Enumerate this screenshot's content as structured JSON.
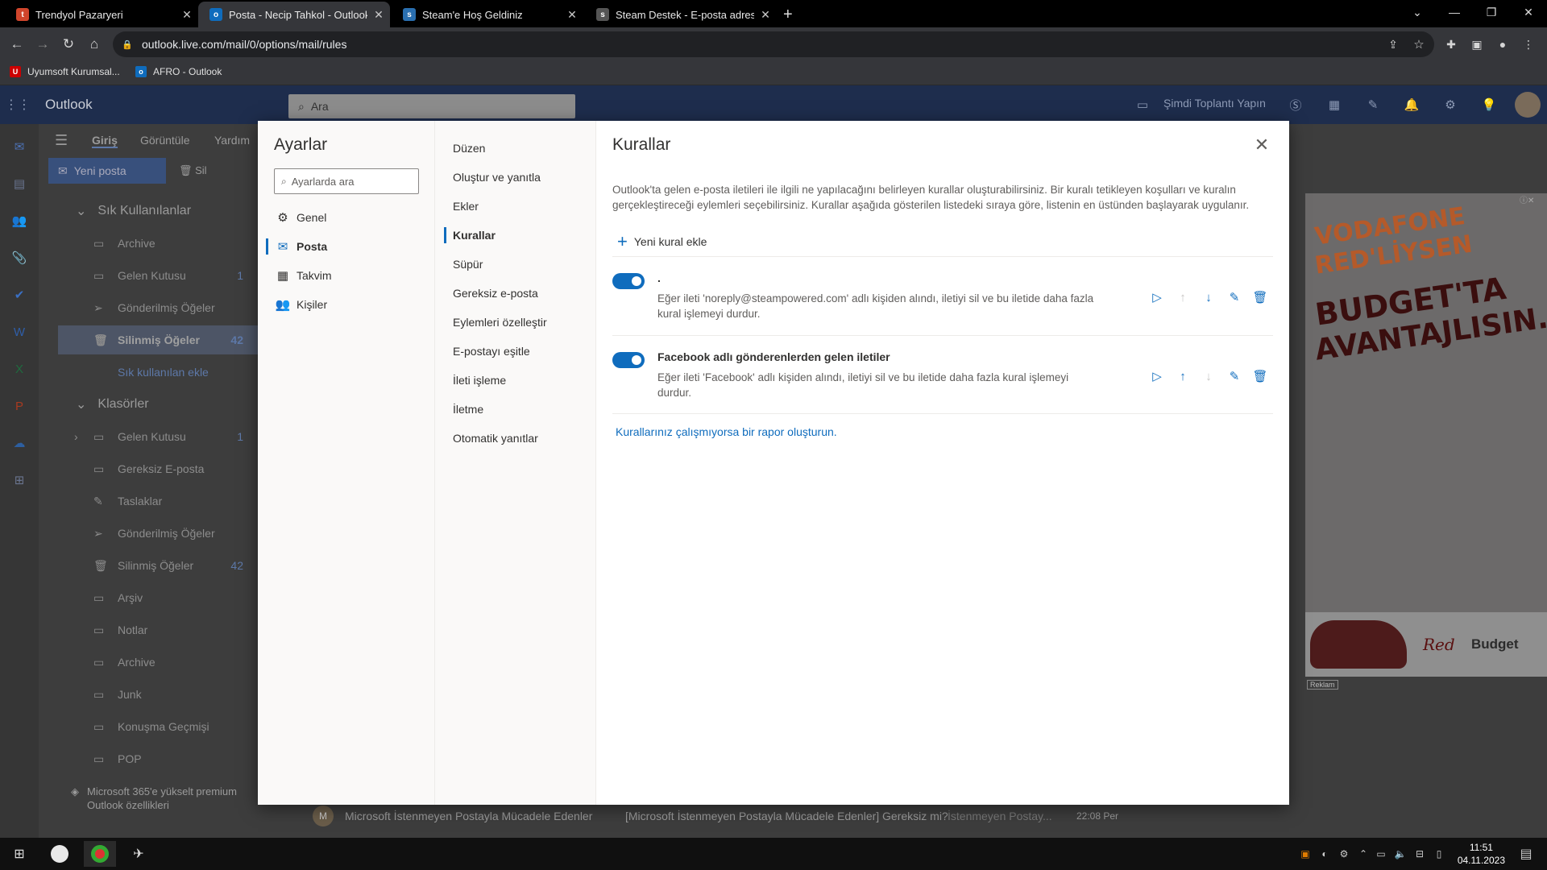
{
  "browser": {
    "tabs": [
      {
        "title": "Trendyol Pazaryeri",
        "icon": "trendyol-icon",
        "color": "#f27a1a"
      },
      {
        "title": "Posta - Necip Tahkol - Outlook",
        "icon": "outlook-icon",
        "color": "#0f6cbd"
      },
      {
        "title": "Steam'e Hoş Geldiniz",
        "icon": "steam-icon",
        "color": "#1b2838"
      },
      {
        "title": "Steam Destek - E-posta adresim...",
        "icon": "steam-icon",
        "color": "#1b2838"
      }
    ],
    "url": "outlook.live.com/mail/0/options/mail/rules",
    "bookmarks": [
      "Uyumsoft Kurumsal...",
      "AFRO - Outlook"
    ]
  },
  "outlook": {
    "brand": "Outlook",
    "search_placeholder": "Ara",
    "meet_now": "Şimdi Toplantı Yapın",
    "ribbon_tabs": [
      "Giriş",
      "Görüntüle",
      "Yardım"
    ],
    "new_mail": "Yeni posta",
    "delete": "Sil",
    "favorites_header": "Sık Kullanılanlar",
    "favorites": [
      {
        "label": "Archive",
        "count": ""
      },
      {
        "label": "Gelen Kutusu",
        "count": "1"
      },
      {
        "label": "Gönderilmiş Öğeler",
        "count": ""
      },
      {
        "label": "Silinmiş Öğeler",
        "count": "42"
      }
    ],
    "add_favorite": "Sık kullanılan ekle",
    "folders_header": "Klasörler",
    "folders": [
      {
        "label": "Gelen Kutusu",
        "count": "1"
      },
      {
        "label": "Gereksiz E-posta",
        "count": ""
      },
      {
        "label": "Taslaklar",
        "count": ""
      },
      {
        "label": "Gönderilmiş Öğeler",
        "count": ""
      },
      {
        "label": "Silinmiş Öğeler",
        "count": "42"
      },
      {
        "label": "Arşiv",
        "count": ""
      },
      {
        "label": "Notlar",
        "count": ""
      },
      {
        "label": "Archive",
        "count": ""
      },
      {
        "label": "Junk",
        "count": ""
      },
      {
        "label": "Konuşma Geçmişi",
        "count": ""
      },
      {
        "label": "POP",
        "count": ""
      }
    ],
    "upgrade": "Microsoft 365'e yükselt premium Outlook özellikleri",
    "mail_row": {
      "sender": "Microsoft İstenmeyen Postayla Mücadele Edenler",
      "subject": "[Microsoft İstenmeyen Postayla Mücadele Edenler] Gereksiz mi?",
      "preview": "İstenmeyen Postay...",
      "time": "22:08 Per"
    }
  },
  "settings": {
    "title": "Ayarlar",
    "search_placeholder": "Ayarlarda ara",
    "nav": [
      {
        "label": "Genel",
        "icon": "gear-icon"
      },
      {
        "label": "Posta",
        "icon": "mail-icon"
      },
      {
        "label": "Takvim",
        "icon": "calendar-icon"
      },
      {
        "label": "Kişiler",
        "icon": "people-icon"
      }
    ],
    "sub": [
      "Düzen",
      "Oluştur ve yanıtla",
      "Ekler",
      "Kurallar",
      "Süpür",
      "Gereksiz e-posta",
      "Eylemleri özelleştir",
      "E-postayı eşitle",
      "İleti işleme",
      "İletme",
      "Otomatik yanıtlar"
    ],
    "rules": {
      "title": "Kurallar",
      "description": "Outlook'ta gelen e-posta iletileri ile ilgili ne yapılacağını belirleyen kurallar oluşturabilirsiniz. Bir kuralı tetikleyen koşulları ve kuralın gerçekleştireceği eylemleri seçebilirsiniz. Kurallar aşağıda gösterilen listedeki sıraya göre, listenin en üstünden başlayarak uygulanır.",
      "add_rule": "Yeni kural ekle",
      "items": [
        {
          "name": ".",
          "enabled": true,
          "description": "Eğer ileti 'noreply@steampowered.com' adlı kişiden alındı, iletiyi sil ve bu iletide daha fazla kural işlemeyi durdur."
        },
        {
          "name": "Facebook adlı gönderenlerden gelen iletiler",
          "enabled": true,
          "description": "Eğer ileti 'Facebook' adlı kişiden alındı, iletiyi sil ve bu iletide daha fazla kural işlemeyi durdur."
        }
      ],
      "report_link": "Kurallarınız çalışmıyorsa bir rapor oluşturun."
    }
  },
  "ad": {
    "line1": "VODAFONE",
    "line2": "RED'LİYSEN",
    "line3": "BUDGET'TA",
    "line4": "AVANTAJLISIN.",
    "logo_red": "Red",
    "logo_budget": "Budget",
    "label": "Reklam"
  },
  "taskbar": {
    "time": "11:51",
    "date": "04.11.2023"
  }
}
